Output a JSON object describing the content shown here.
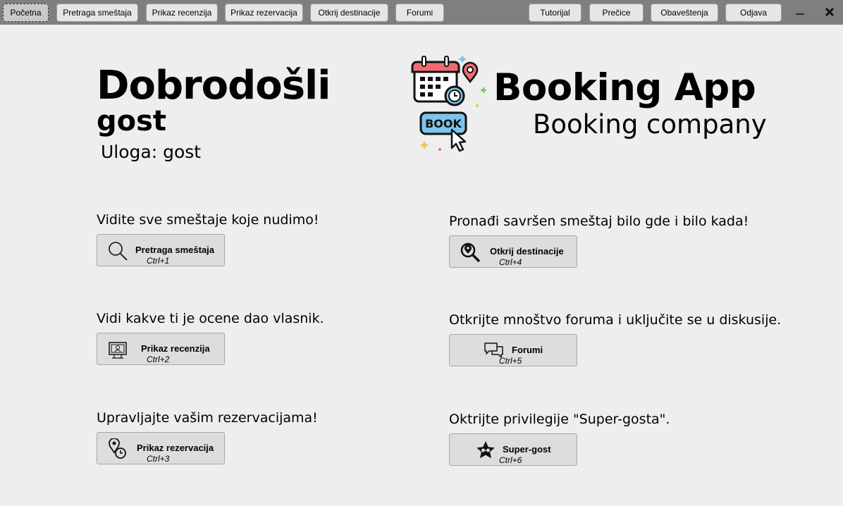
{
  "nav": {
    "left": [
      "Početna",
      "Pretraga smeštaja",
      "Prikaz recenzija",
      "Prikaz rezervacija",
      "Otkrij destinacije",
      "Forumi"
    ],
    "right": [
      "Tutorijal",
      "Prečice",
      "Obaveštenja",
      "Odjava"
    ],
    "minimize": "—",
    "close": "✕"
  },
  "header": {
    "welcome": "Dobrodošli",
    "username": "gost",
    "role_label": "Uloga:",
    "role_value": "gost",
    "app_title": "Booking App",
    "app_subtitle": "Booking company",
    "logo_text": "BOOK"
  },
  "features": [
    {
      "text": "Vidite sve smeštaje koje nudimo!",
      "button": "Pretraga smeštaja",
      "shortcut": "Ctrl+1",
      "icon": "search-icon"
    },
    {
      "text": "Pronađi savršen smeštaj bilo gde i bilo kada!",
      "button": "Otkrij destinacije",
      "shortcut": "Ctrl+4",
      "icon": "location-search-icon"
    },
    {
      "text": "Vidi kakve ti je ocene dao vlasnik.",
      "button": "Prikaz recenzija",
      "shortcut": "Ctrl+2",
      "icon": "review-icon"
    },
    {
      "text": "Otkrijte mnoštvo foruma i uključite se u diskusije.",
      "button": "Forumi",
      "shortcut": "Ctrl+5",
      "icon": "chat-icon"
    },
    {
      "text": "Upravljajte vašim rezervacijama!",
      "button": "Prikaz rezervacija",
      "shortcut": "Ctrl+3",
      "icon": "reservation-icon"
    },
    {
      "text": "Oktrijte privilegije \"Super-gosta\".",
      "button": "Super-gost",
      "shortcut": "Ctrl+6",
      "icon": "star-icon"
    }
  ],
  "colors": {
    "topbar": "#7f7f7f",
    "background": "#eeeeee",
    "button": "#dddddd"
  }
}
